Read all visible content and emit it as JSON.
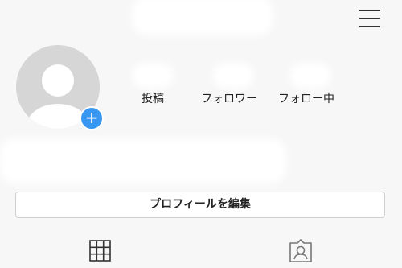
{
  "profile": {
    "add_photo_badge": "+",
    "stats": {
      "posts_label": "投稿",
      "followers_label": "フォロワー",
      "following_label": "フォロー中"
    },
    "edit_profile_label": "プロフィールを編集"
  },
  "icons": {
    "menu": "hamburger-menu-icon",
    "grid": "grid-icon",
    "tagged": "tagged-person-icon"
  },
  "colors": {
    "accent": "#3897f0",
    "background": "#f7f7f7",
    "avatar_placeholder": "#d6d6d6"
  }
}
